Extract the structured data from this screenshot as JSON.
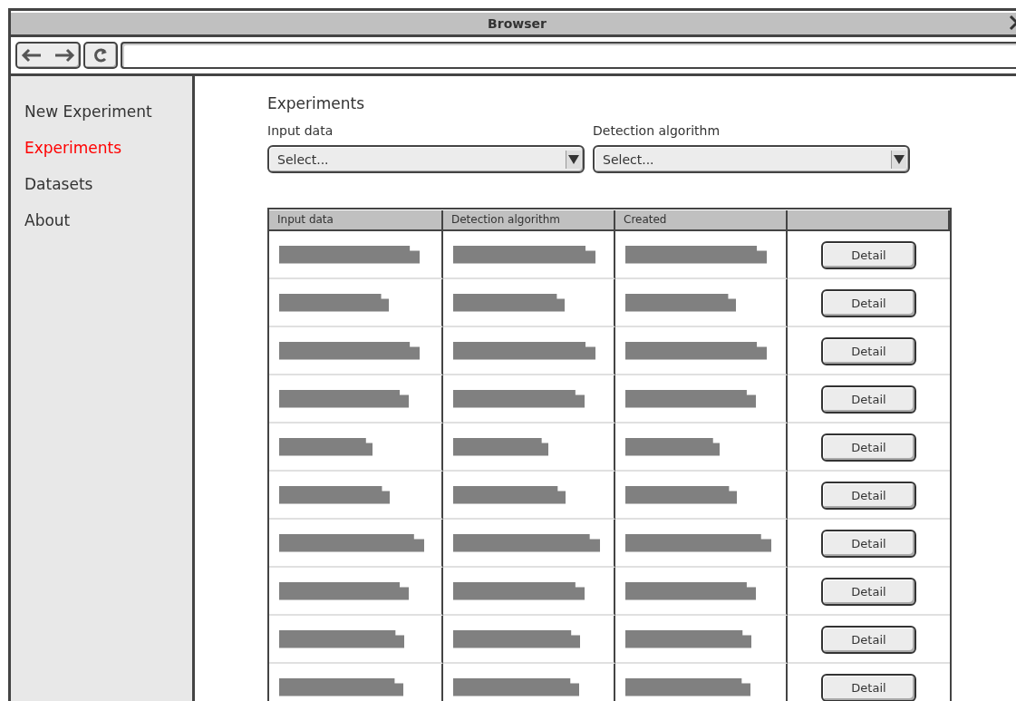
{
  "window": {
    "title": "Browser"
  },
  "sidebar": {
    "items": [
      {
        "label": "New Experiment",
        "selected": false
      },
      {
        "label": "Experiments",
        "selected": true
      },
      {
        "label": "Datasets",
        "selected": false
      },
      {
        "label": "About",
        "selected": false
      }
    ]
  },
  "page": {
    "title": "Experiments",
    "filters": [
      {
        "label": "Input data",
        "value": "Select..."
      },
      {
        "label": "Detection algorithm",
        "value": "Select..."
      }
    ]
  },
  "table": {
    "columns": [
      "Input data",
      "Detection algorithm",
      "Created"
    ],
    "rows": [
      {
        "action": "Detail"
      },
      {
        "action": "Detail"
      },
      {
        "action": "Detail"
      },
      {
        "action": "Detail"
      },
      {
        "action": "Detail"
      },
      {
        "action": "Detail"
      },
      {
        "action": "Detail"
      },
      {
        "action": "Detail"
      },
      {
        "action": "Detail"
      },
      {
        "action": "Detail"
      }
    ]
  }
}
